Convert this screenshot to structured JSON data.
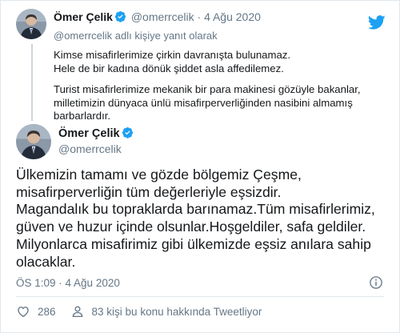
{
  "parent_tweet": {
    "name": "Ömer Çelik",
    "handle": "@omerrcelik",
    "separator": "·",
    "date": "4 Ağu 2020",
    "replying_to": "@omerrcelik adlı kişiye yanıt olarak",
    "lines": [
      "Kimse misafirlerimize çirkin davranışta bulunamaz.",
      "Hele de bir kadına dönük şiddet asla affedilemez.",
      "Turist misafirlerimize mekanik bir para makinesi gözüyle bakanlar,",
      "milletimizin dünyaca ünlü misafirperverliğinden nasibini almamış",
      "barbarlardır."
    ]
  },
  "main_tweet": {
    "name": "Ömer Çelik",
    "handle": "@omerrcelik",
    "lines": [
      "Ülkemizin tamamı ve gözde bölgemiz Çeşme,",
      "misafirperverliğin tüm değerleriyle eşsizdir.",
      "Magandalık bu topraklarda barınamaz.Tüm misafirlerimiz,",
      "güven ve huzur içinde olsunlar.Hoşgeldiler, safa geldiler.",
      "Milyonlarca misafirimiz gibi ülkemizde eşsiz anılara sahip",
      "olacaklar."
    ],
    "timestamp": "ÖS 1:09 · 4 Ağu 2020",
    "like_count": "286",
    "people_talking": "83 kişi bu konu hakkında Tweetliyor"
  },
  "colors": {
    "verified_blue": "#1da1f2",
    "twitter_blue": "#1da1f2",
    "muted": "#657786",
    "text": "#14171a"
  },
  "icons": {
    "brand": "twitter-bird-icon",
    "verified": "verified-badge-icon",
    "info": "info-icon",
    "like": "heart-icon",
    "conversation": "person-icon"
  }
}
